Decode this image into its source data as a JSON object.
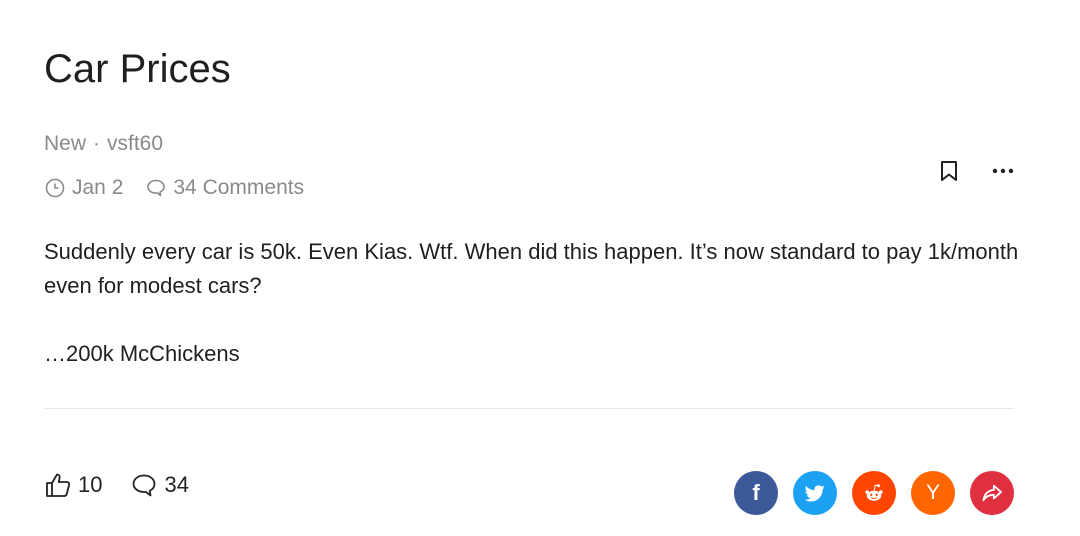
{
  "post": {
    "title": "Car Prices",
    "flair": "New",
    "separator": "·",
    "author": "vsft60",
    "date": "Jan 2",
    "comments_label": "34 Comments",
    "body": [
      "Suddenly every car is 50k. Even Kias. Wtf. When did this happen. It’s now standard to pay 1k/month even for modest cars?",
      "…200k McChickens"
    ]
  },
  "actions": {
    "bookmark_icon": "bookmark-icon",
    "more_icon": "more-icon"
  },
  "footer": {
    "likes": "10",
    "comments": "34"
  },
  "share": {
    "buttons": [
      {
        "name": "facebook",
        "glyph": "f",
        "color": "#3b5998"
      },
      {
        "name": "twitter",
        "glyph": "twitter-bird",
        "color": "#1da1f2"
      },
      {
        "name": "reddit",
        "glyph": "reddit-alien",
        "color": "#ff4500"
      },
      {
        "name": "hacker-news",
        "glyph": "Y",
        "color": "#ff6600"
      },
      {
        "name": "share",
        "glyph": "share-arrow",
        "color": "#e0303f"
      }
    ]
  }
}
